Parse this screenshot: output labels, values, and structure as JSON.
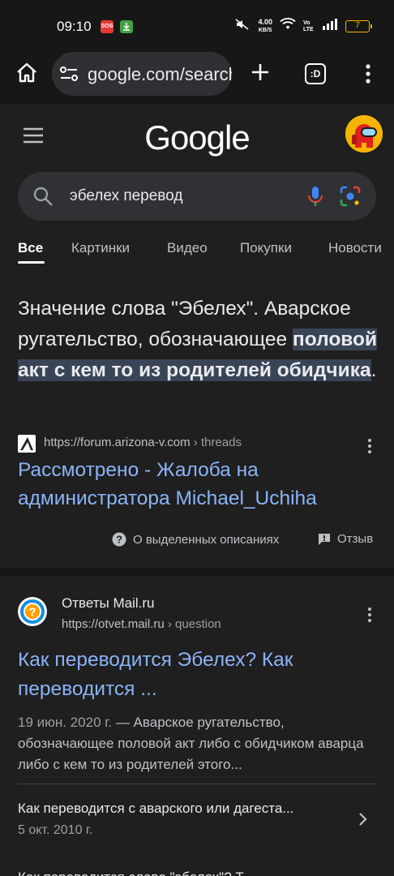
{
  "status_bar": {
    "time": "09:10",
    "sos_badge": "SOS",
    "speed_value": "4.00",
    "speed_unit": "KB/S",
    "volte": "Vo LTE",
    "battery": "7",
    "icons": [
      "sos-icon",
      "download-icon",
      "mute-icon",
      "wifi-icon",
      "signal-icon",
      "battery-icon"
    ]
  },
  "browser": {
    "url": "google.com/search",
    "tab_count_label": ":D",
    "icons": [
      "home-icon",
      "tune-icon",
      "plus-icon",
      "tabs-icon",
      "more-vert-icon"
    ]
  },
  "google_header": {
    "logo": "Google"
  },
  "search": {
    "query": "эбелех перевод"
  },
  "tabs": [
    {
      "label": "Все",
      "active": true
    },
    {
      "label": "Картинки",
      "active": false
    },
    {
      "label": "Видео",
      "active": false
    },
    {
      "label": "Покупки",
      "active": false
    },
    {
      "label": "Новости",
      "active": false
    }
  ],
  "featured_snippet": {
    "text_before": "Значение слова \"Эбелех\". Аварское ругательство, обозначающее ",
    "text_highlight": "половой акт с кем то из родителей обидчика",
    "text_after": ".",
    "source_url": "https://forum.arizona-v.com",
    "source_crumb": " › threads",
    "source_title": "Рассмотрено - Жалоба на администратора Michael_Uchiha",
    "about_label": "О выделенных описаниях",
    "feedback_label": "Отзыв"
  },
  "result2": {
    "site_name": "Ответы Mail.ru",
    "url": "https://otvet.mail.ru",
    "crumb": " › question",
    "title": "Как переводится Эбелех? Как переводится ...",
    "date": "19 июн. 2020 г.",
    "snippet": " — Аварское ругательство, обозначающее половой акт либо с обидчиком аварца либо с кем то из родителей этого...",
    "related_title": "Как переводится с аварского или дагеста...",
    "related_date": "5 окт. 2010 г.",
    "next_partial": "Как переводится слово \"эбелех\"? Т..."
  },
  "colors": {
    "background": "#1f1f1f",
    "link": "#8ab4f8",
    "highlight": "#394457",
    "battery": "#ffb300"
  }
}
